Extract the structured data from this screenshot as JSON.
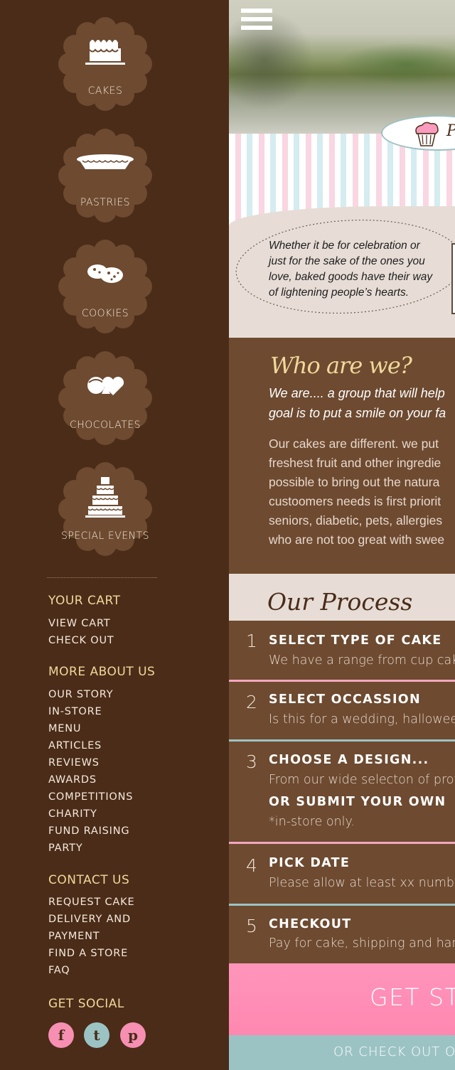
{
  "categories": [
    {
      "label": "CAKES",
      "icon": "cake-icon"
    },
    {
      "label": "PASTRIES",
      "icon": "pie-icon"
    },
    {
      "label": "COOKIES",
      "icon": "cookies-icon"
    },
    {
      "label": "CHOCOLATES",
      "icon": "chocolates-icon"
    },
    {
      "label": "SPECIAL EVENTS",
      "icon": "tiered-cake-icon"
    }
  ],
  "sidebar": {
    "cart": {
      "heading": "YOUR CART",
      "links": [
        "VIEW CART",
        "CHECK OUT"
      ]
    },
    "about": {
      "heading": "MORE ABOUT US",
      "links": [
        "OUR STORY",
        "IN-STORE",
        "MENU",
        "ARTICLES",
        "REVIEWS",
        "AWARDS",
        "COMPETITIONS",
        "CHARITY",
        "FUND RAISING",
        "PARTY"
      ]
    },
    "contact": {
      "heading": "CONTACT US",
      "links": [
        "REQUEST CAKE",
        "DELIVERY AND",
        "PAYMENT",
        "FIND A STORE",
        "FAQ"
      ]
    },
    "social": {
      "heading": "GET SOCIAL",
      "icons": [
        "facebook-icon",
        "twitter-icon",
        "pinterest-icon"
      ]
    }
  },
  "logo": {
    "initial": "P"
  },
  "intro": {
    "lines": [
      "Whether it be for celebration or",
      "just for the sake of the ones you",
      "love, baked goods have their way",
      "of lightening people’s hearts."
    ]
  },
  "who": {
    "title": "Who are we?",
    "lead_lines": [
      "We are.... a group that will help",
      "goal is to put a smile on your fa"
    ],
    "body_lines": [
      "Our cakes are different. we put",
      "freshest fruit and other ingredie",
      "possible to bring out the natura",
      "custoomers needs is first priorit",
      "seniors, diabetic, pets, allergies",
      "who are not too great with swee"
    ]
  },
  "process": {
    "title": "Our Process",
    "steps": [
      {
        "num": "1",
        "title": "SELECT TYPE OF CAKE",
        "desc": "We have a range from cup cake"
      },
      {
        "num": "2",
        "title": "SELECT OCCASSION",
        "desc": "Is this for a wedding, halloween"
      },
      {
        "num": "3",
        "title": "CHOOSE A DESIGN...",
        "desc": "From our wide selecton of profe",
        "title2": "OR SUBMIT YOUR OWN",
        "desc2": "*in-store only."
      },
      {
        "num": "4",
        "title": "PICK DATE",
        "desc": "Please allow at least xx number"
      },
      {
        "num": "5",
        "title": "CHECKOUT",
        "desc": "Pay for cake, shipping and hand"
      }
    ]
  },
  "cta": {
    "primary": "GET ST",
    "secondary": "OR CHECK OUT O"
  },
  "colors": {
    "sidebar": "#4a2c18",
    "brown": "#6d4a30",
    "gold": "#f0d89b",
    "pink": "#ff8fb5",
    "blue": "#9cc3c4",
    "cream": "#e7ddd6"
  }
}
